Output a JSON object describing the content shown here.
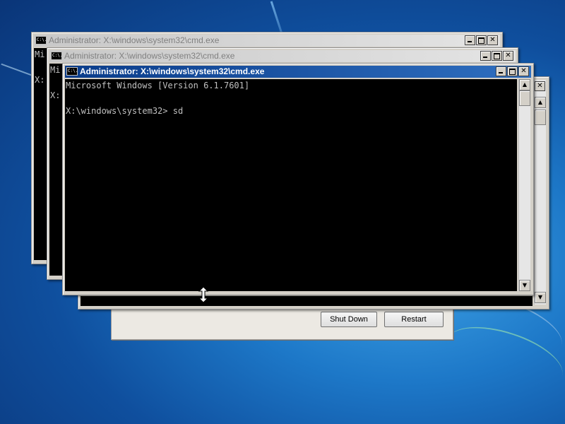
{
  "dialog": {
    "shutdown_label": "Shut Down",
    "restart_label": "Restart"
  },
  "windows": [
    {
      "title": "Administrator: X:\\windows\\system32\\cmd.exe",
      "icon_text": "C:\\.",
      "lines": [
        "Mi",
        "",
        "X:"
      ]
    },
    {
      "title": "Administrator: X:\\windows\\system32\\cmd.exe",
      "icon_text": "C:\\.",
      "lines": [
        "Mi",
        "",
        "X:"
      ]
    },
    {
      "title": "Administrator: X:\\windows\\system32\\cmd.exe",
      "icon_text": "C:\\.",
      "lines": [
        "Microsoft Windows [Version 6.1.7601]",
        "",
        "X:\\windows\\system32> sd"
      ]
    }
  ],
  "caption_buttons": {
    "close_glyph": "✕"
  },
  "scroll": {
    "up_glyph": "▲",
    "down_glyph": "▼"
  },
  "cursor": {
    "icon": "resize-vertical-cursor-icon"
  }
}
